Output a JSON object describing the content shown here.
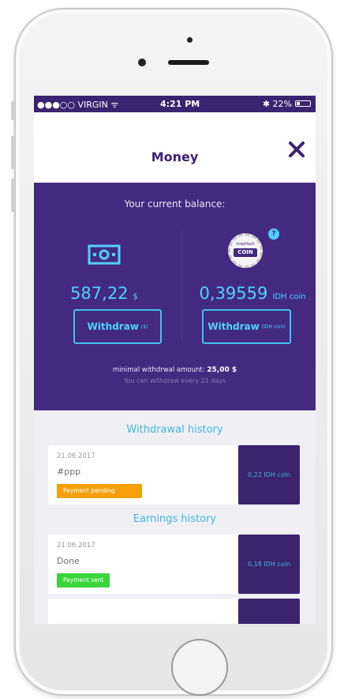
{
  "status": {
    "carrier": "●●●○○ VIRGIN ᯤ",
    "time": "4:21 PM",
    "battery": "✱ 22%"
  },
  "header": {
    "title": "Money"
  },
  "balance": {
    "title": "Your current balance:",
    "usd": {
      "amount": "587,22",
      "unit": "$",
      "button": "Withdraw",
      "button_unit": "($)"
    },
    "coin": {
      "amount": "0,39559",
      "unit": "IDH coin",
      "button": "Withdraw",
      "button_unit": "(IDH coin)",
      "logo_top": "indaHash",
      "logo_text": "COIN",
      "help": "?"
    },
    "minimal_label": "minimal withdrwal amount:",
    "minimal_value": "25,00 $",
    "frequency": "You can withdraw every 21 days"
  },
  "withdrawal_history": {
    "title": "Withdrawal history",
    "items": [
      {
        "date": "21.06.2017",
        "desc": "#ppp",
        "status": "Payment pending",
        "amount": "0,22 IDH coin"
      }
    ]
  },
  "earnings_history": {
    "title": "Earnings history",
    "items": [
      {
        "date": "21.06.2017",
        "desc": "Done",
        "status": "Payment sent",
        "amount": "0,18 IDH coin"
      }
    ]
  },
  "colors": {
    "primary": "#432a80",
    "accent": "#4fd1ff",
    "pending": "#f5a00a",
    "sent": "#3bd43b"
  }
}
